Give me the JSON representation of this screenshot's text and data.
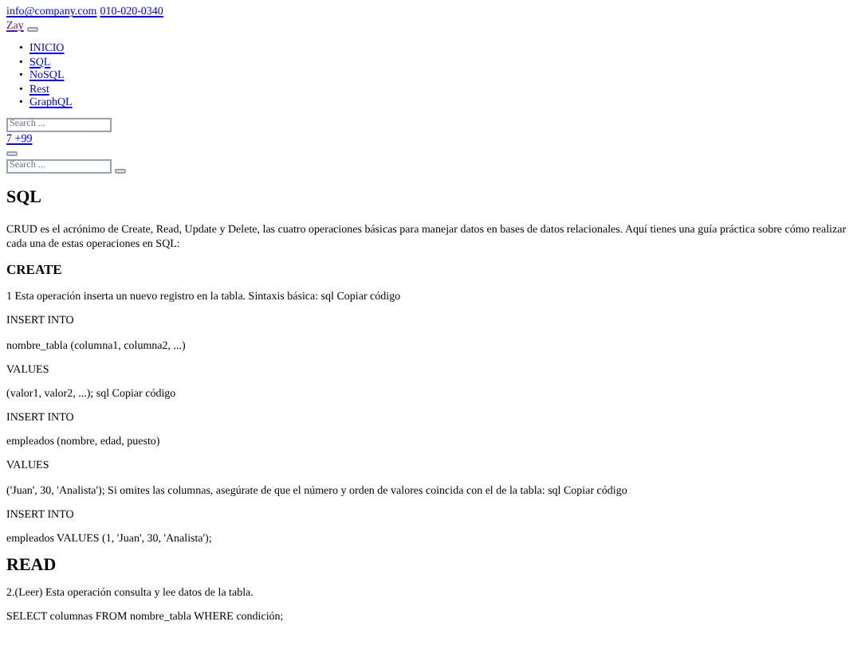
{
  "contact": {
    "email": "info@company.com",
    "phone": "010-020-0340"
  },
  "user": {
    "name": "Zay"
  },
  "nav": [
    {
      "marker": "•",
      "label": "INICIO"
    },
    {
      "marker": "•",
      "label": "SQL"
    },
    {
      "marker": "•",
      "label": "NoSQL"
    },
    {
      "marker": "•",
      "label": "Rest"
    },
    {
      "marker": "•",
      "label": "GraphQL"
    }
  ],
  "search_top": {
    "placeholder": "Search ..."
  },
  "notifications_link": "7 +99",
  "search_bottom": {
    "placeholder": "Search ..."
  },
  "article": {
    "title": "SQL",
    "blocks": [
      {
        "kind": "p",
        "text": "CRUD es el acrónimo de Create, Read, Update y Delete, las cuatro operaciones básicas para manejar datos en bases de datos relacionales. Aquí tienes una guía práctica sobre cómo realizar cada una de estas operaciones en SQL:"
      },
      {
        "kind": "h2",
        "text": "CREATE"
      },
      {
        "kind": "p",
        "text": "1 Esta operación inserta un nuevo registro en la tabla. Sintaxis básica: sql Copiar código"
      },
      {
        "kind": "p",
        "text": "INSERT INTO"
      },
      {
        "kind": "p",
        "text": "nombre_tabla (columna1, columna2, ...)"
      },
      {
        "kind": "p",
        "text": "VALUES"
      },
      {
        "kind": "p",
        "text": "(valor1, valor2, ...); sql Copiar código"
      },
      {
        "kind": "p",
        "text": "INSERT INTO"
      },
      {
        "kind": "p",
        "text": "empleados (nombre, edad, puesto)"
      },
      {
        "kind": "p",
        "text": "VALUES"
      },
      {
        "kind": "p",
        "text": "('Juan', 30, 'Analista'); Si omites las columnas, asegúrate de que el número y orden de valores coincida con el de la tabla: sql Copiar código"
      },
      {
        "kind": "p",
        "text": "INSERT INTO"
      },
      {
        "kind": "p",
        "text": "empleados VALUES (1, 'Juan', 30, 'Analista');"
      },
      {
        "kind": "h1",
        "text": "READ"
      },
      {
        "kind": "p",
        "text": "2.(Leer) Esta operación consulta y lee datos de la tabla."
      },
      {
        "kind": "p",
        "text": "SELECT columnas FROM nombre_tabla WHERE condición;"
      }
    ]
  }
}
